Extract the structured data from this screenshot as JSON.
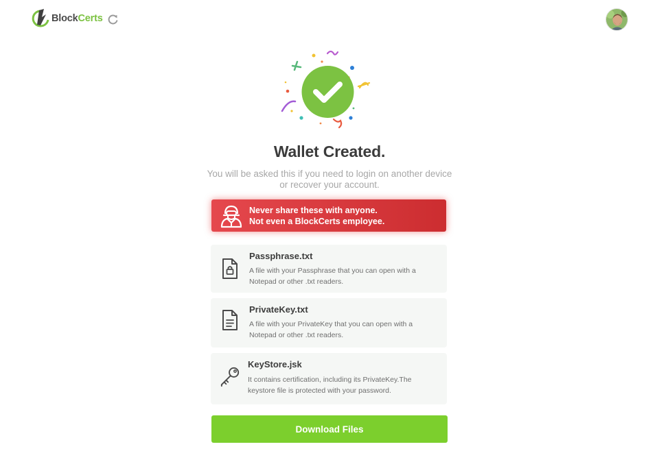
{
  "header": {
    "logo_text_main": "Block",
    "logo_text_accent": "Certs",
    "refresh_icon": "refresh-icon",
    "avatar_icon": "user-avatar"
  },
  "hero": {
    "icon": "check-circle-icon",
    "title": "Wallet Created.",
    "subtitle": "You will be asked this if you need to login on another device or recover your account."
  },
  "warning": {
    "icon": "anonymous-agent-icon",
    "line1": "Never share these with anyone.",
    "line2": "Not even a BlockCerts employee."
  },
  "files": [
    {
      "name": "Passphrase.txt",
      "description": "A file with your Passphrase that you can open with a Notepad or other .txt readers.",
      "icon": "locked-file-icon"
    },
    {
      "name": "PrivateKey.txt",
      "description": "A file with your PrivateKey that you can open with a Notepad or other .txt readers.",
      "icon": "text-file-icon"
    },
    {
      "name": "KeyStore.jsk",
      "description": "It contains certification, including its PrivateKey.The keystore file is protected with your password.",
      "icon": "key-icon"
    }
  ],
  "actions": {
    "download_label": "Download Files"
  },
  "colors": {
    "brand_green": "#7cc242",
    "button_green": "#7ccf2d",
    "warning_red": "#d9363a",
    "card_bg": "#f5f7f5"
  }
}
